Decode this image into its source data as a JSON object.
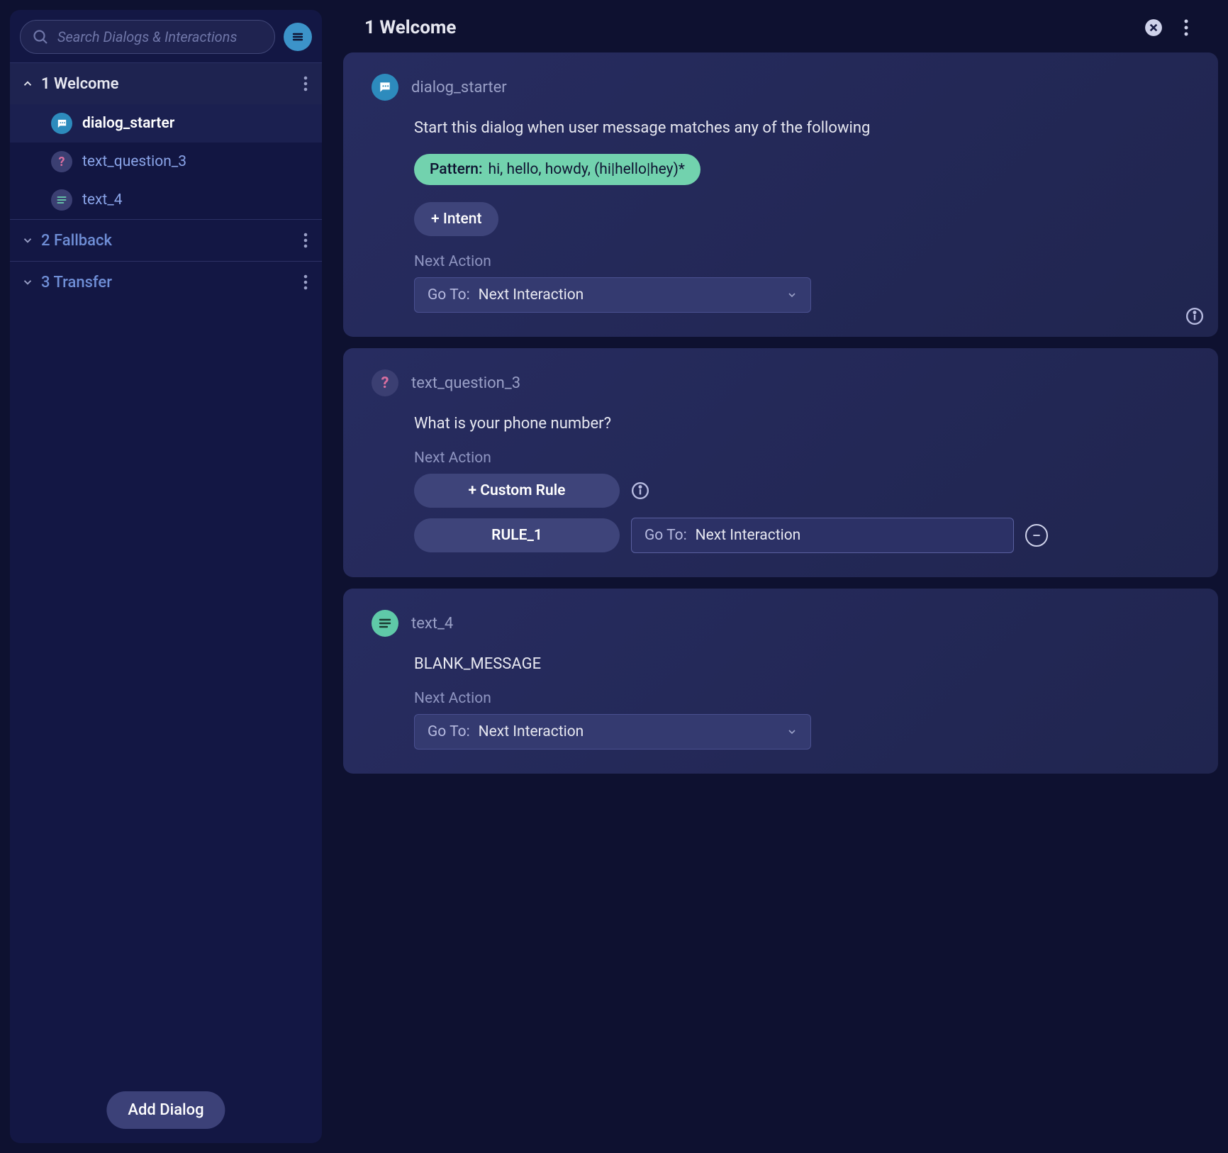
{
  "sidebar": {
    "search_placeholder": "Search Dialogs & Interactions",
    "add_dialog_label": "Add Dialog",
    "dialogs": [
      {
        "id": "welcome",
        "title": "1 Welcome",
        "expanded": true,
        "items": [
          {
            "id": "dialog_starter",
            "label": "dialog_starter",
            "icon": "chat",
            "active": true
          },
          {
            "id": "text_question_3",
            "label": "text_question_3",
            "icon": "question",
            "active": false
          },
          {
            "id": "text_4",
            "label": "text_4",
            "icon": "text",
            "active": false
          }
        ]
      },
      {
        "id": "fallback",
        "title": "2 Fallback",
        "expanded": false,
        "items": []
      },
      {
        "id": "transfer",
        "title": "3 Transfer",
        "expanded": false,
        "items": []
      }
    ]
  },
  "main": {
    "title": "1 Welcome",
    "cards": [
      {
        "id": "dialog_starter",
        "icon": "chat",
        "name": "dialog_starter",
        "description": "Start this dialog when user message matches any of the following",
        "pattern": {
          "label": "Pattern:",
          "value": "hi, hello, howdy, (hi|hello|hey)*"
        },
        "add_intent_label": "+ Intent",
        "next_action_label": "Next Action",
        "select": {
          "prefix": "Go To:",
          "value": "Next Interaction"
        }
      },
      {
        "id": "text_question_3",
        "icon": "question",
        "name": "text_question_3",
        "message": "What is your phone number?",
        "next_action_label": "Next Action",
        "custom_rule_label": "+ Custom Rule",
        "rule": {
          "name": "RULE_1",
          "select": {
            "prefix": "Go To:",
            "value": "Next Interaction"
          }
        }
      },
      {
        "id": "text_4",
        "icon": "text",
        "name": "text_4",
        "message": "BLANK_MESSAGE",
        "next_action_label": "Next Action",
        "select": {
          "prefix": "Go To:",
          "value": "Next Interaction"
        }
      }
    ]
  }
}
